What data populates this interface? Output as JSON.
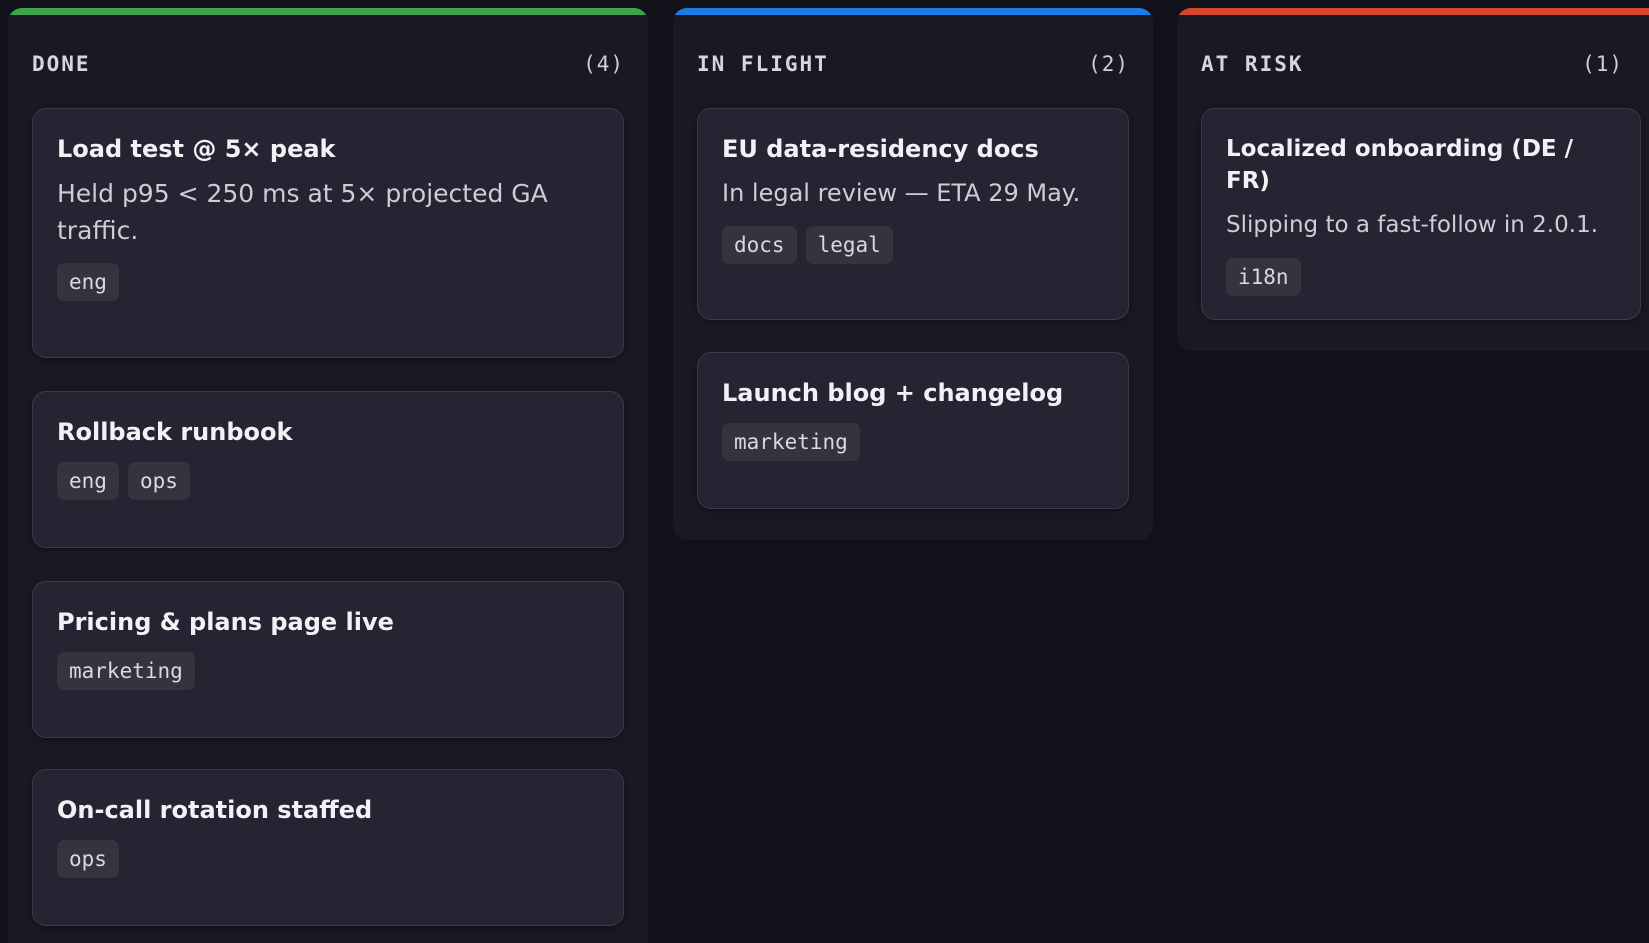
{
  "columns": [
    {
      "title": "DONE",
      "count": "(4)",
      "accent": "#3fa34d",
      "cards": [
        {
          "title": "Load test @ 5× peak",
          "desc": "Held p95 < 250 ms at 5× projected GA traffic.",
          "tags": [
            "eng"
          ]
        },
        {
          "title": "Rollback runbook",
          "desc": "",
          "tags": [
            "eng",
            "ops"
          ]
        },
        {
          "title": "Pricing & plans page live",
          "desc": "",
          "tags": [
            "marketing"
          ]
        },
        {
          "title": "On-call rotation staffed",
          "desc": "",
          "tags": [
            "ops"
          ]
        }
      ]
    },
    {
      "title": "IN FLIGHT",
      "count": "(2)",
      "accent": "#1c7ce6",
      "cards": [
        {
          "title": "EU data-residency docs",
          "desc": "In legal review — ETA 29 May.",
          "tags": [
            "docs",
            "legal"
          ]
        },
        {
          "title": "Launch blog + changelog",
          "desc": "",
          "tags": [
            "marketing"
          ]
        }
      ]
    },
    {
      "title": "AT RISK",
      "count": "(1)",
      "accent": "#d9452f",
      "cards": [
        {
          "title": "Localized onboarding (DE / FR)",
          "desc": "Slipping to a fast-follow in 2.0.1.",
          "tags": [
            "i18n"
          ]
        }
      ]
    }
  ]
}
